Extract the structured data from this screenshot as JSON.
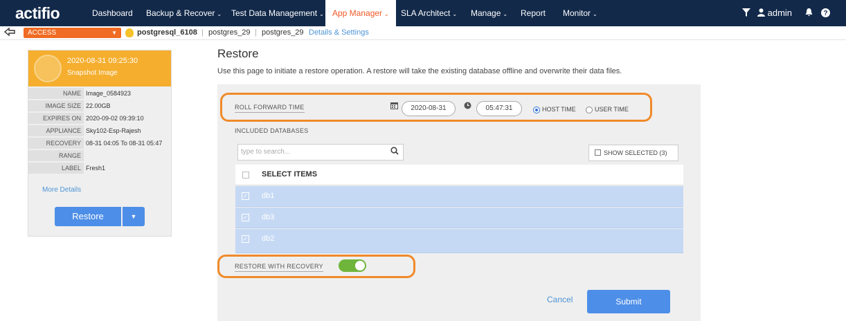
{
  "app": {
    "logo": "actifio"
  },
  "nav": {
    "items": [
      {
        "label": "Dashboard",
        "caret": ""
      },
      {
        "label": "Backup & Recover",
        "caret": "⌄"
      },
      {
        "label": "Test Data Management",
        "caret": "⌄"
      },
      {
        "label": "App Manager",
        "caret": "⌄"
      },
      {
        "label": "SLA Architect",
        "caret": "⌄"
      },
      {
        "label": "Manage",
        "caret": "⌄"
      },
      {
        "label": "Report",
        "caret": ""
      },
      {
        "label": "Monitor",
        "caret": "⌄"
      }
    ],
    "active": "App Manager",
    "user": "admin"
  },
  "breadcrumb": {
    "access": "ACCESS",
    "app": "postgresql_6108",
    "host": "postgres_29",
    "instance": "postgres_29",
    "details": "Details & Settings"
  },
  "snapshot": {
    "datetime": "2020-08-31  09:25:30",
    "type": "Snapshot Image",
    "rows": [
      {
        "key": "NAME",
        "value": "Image_0584923"
      },
      {
        "key": "IMAGE SIZE",
        "value": "22.00GB"
      },
      {
        "key": "EXPIRES ON",
        "value": "2020-09-02 09:39:10"
      },
      {
        "key": "APPLIANCE",
        "value": "Sky102-Esp-Rajesh"
      },
      {
        "key": "RECOVERY",
        "value": "08-31 04:05 To 08-31 05:47"
      },
      {
        "key": "RANGE",
        "value": ""
      },
      {
        "key": "LABEL",
        "value": "Fresh1"
      }
    ],
    "more_details": "More Details",
    "restore_label": "Restore"
  },
  "restore": {
    "title": "Restore",
    "description": "Use this page to initiate a restore operation. A restore will take the existing database offline and overwrite their data files.",
    "roll_forward_label": "ROLL FORWARD TIME",
    "date": "2020-08-31",
    "time": "05:47:31",
    "host_time": "HOST TIME",
    "user_time": "USER TIME",
    "selected_time_mode": "HOST TIME",
    "included_label": "INCLUDED DATABASES",
    "search_placeholder": "type to search...",
    "show_selected": "SHOW SELECTED (3)",
    "select_items": "SELECT ITEMS",
    "databases": [
      "db1",
      "db3",
      "db2"
    ],
    "recovery_label": "RESTORE WITH RECOVERY",
    "recovery_on": true,
    "cancel": "Cancel",
    "submit": "Submit"
  },
  "colors": {
    "nav_bg": "#12294a",
    "accent_orange": "#f08a2a",
    "primary_blue": "#4d8ee8",
    "selected_row": "#c6d9f4",
    "toggle_on": "#6fb53b"
  }
}
